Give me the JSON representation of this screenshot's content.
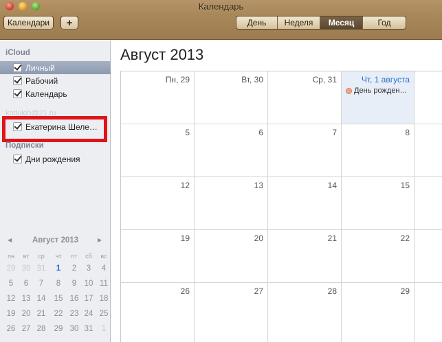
{
  "window": {
    "title": "Календарь"
  },
  "toolbar": {
    "calendars_label": "Календари",
    "add_label": "+",
    "views": [
      {
        "label": "День",
        "active": false
      },
      {
        "label": "Неделя",
        "active": false
      },
      {
        "label": "Месяц",
        "active": true
      },
      {
        "label": "Год",
        "active": false
      }
    ]
  },
  "sidebar": {
    "sections": {
      "icloud": {
        "title": "iCloud",
        "items": [
          {
            "label": "Личный",
            "checked": true,
            "selected": true
          },
          {
            "label": "Рабочий",
            "checked": true,
            "selected": false
          },
          {
            "label": "Календарь",
            "checked": true,
            "selected": false
          }
        ]
      },
      "account": {
        "title": "kotlukin@21.ru",
        "items": [
          {
            "label": "Екатерина Шеле…",
            "checked": true,
            "selected": false
          }
        ]
      },
      "subscriptions": {
        "title": "Подписки",
        "items": [
          {
            "label": "Дни рождения",
            "checked": true,
            "selected": false
          }
        ]
      }
    },
    "mini_calendar": {
      "title": "Август 2013",
      "weekdays": [
        "пн",
        "вт",
        "ср",
        "чт",
        "пт",
        "сб",
        "вс"
      ],
      "weeks": [
        [
          "29",
          "30",
          "31",
          "1",
          "2",
          "3",
          "4"
        ],
        [
          "5",
          "6",
          "7",
          "8",
          "9",
          "10",
          "11"
        ],
        [
          "12",
          "13",
          "14",
          "15",
          "16",
          "17",
          "18"
        ],
        [
          "19",
          "20",
          "21",
          "22",
          "23",
          "24",
          "25"
        ],
        [
          "26",
          "27",
          "28",
          "29",
          "30",
          "31",
          "1"
        ]
      ]
    }
  },
  "main": {
    "month_title": "Август 2013",
    "weeks": [
      [
        {
          "label": "Пн, 29"
        },
        {
          "label": "Вт, 30"
        },
        {
          "label": "Ср, 31"
        },
        {
          "label": "Чт, 1 августа",
          "highlight": true,
          "event": "День рожден…"
        },
        {
          "label": ""
        }
      ],
      [
        {
          "label": "5"
        },
        {
          "label": "6"
        },
        {
          "label": "7"
        },
        {
          "label": "8"
        },
        {
          "label": ""
        }
      ],
      [
        {
          "label": "12"
        },
        {
          "label": "13"
        },
        {
          "label": "14"
        },
        {
          "label": "15"
        },
        {
          "label": ""
        }
      ],
      [
        {
          "label": "19"
        },
        {
          "label": "20"
        },
        {
          "label": "21"
        },
        {
          "label": "22"
        },
        {
          "label": ""
        }
      ],
      [
        {
          "label": "26"
        },
        {
          "label": "27"
        },
        {
          "label": "28"
        },
        {
          "label": "29"
        },
        {
          "label": ""
        }
      ]
    ]
  }
}
